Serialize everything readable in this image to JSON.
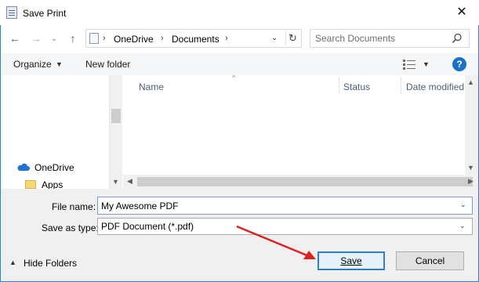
{
  "window": {
    "title": "Save Print",
    "close_icon": "close-icon",
    "border_color": "#2b83d6"
  },
  "nav": {
    "back_icon": "back-arrow-icon",
    "forward_icon": "forward-arrow-icon",
    "recent_icon": "chevron-down-icon",
    "up_icon": "up-arrow-icon"
  },
  "address": {
    "crumbs": [
      "OneDrive",
      "Documents"
    ],
    "refresh_icon": "refresh-icon"
  },
  "search": {
    "placeholder": "Search Documents",
    "icon": "search-icon"
  },
  "toolbar": {
    "organize_label": "Organize",
    "new_folder_label": "New folder",
    "view_icon": "view-options-icon",
    "help_label": "?"
  },
  "sidebar": {
    "items": [
      {
        "label": "OneDrive",
        "icon": "cloud-icon"
      },
      {
        "label": "Apps",
        "icon": "folder-icon"
      }
    ]
  },
  "file_list": {
    "columns": [
      "Name",
      "Status",
      "Date modified"
    ]
  },
  "form": {
    "file_name_label": "File name:",
    "file_name_value": "My Awesome PDF",
    "save_as_type_label": "Save as type:",
    "save_as_type_value": "PDF Document (*.pdf)"
  },
  "footer": {
    "hide_folders_label": "Hide Folders",
    "save_label": "Save",
    "cancel_label": "Cancel",
    "accent_color": "#2b7fd4"
  },
  "annotation": {
    "arrow_color": "#e02020"
  }
}
